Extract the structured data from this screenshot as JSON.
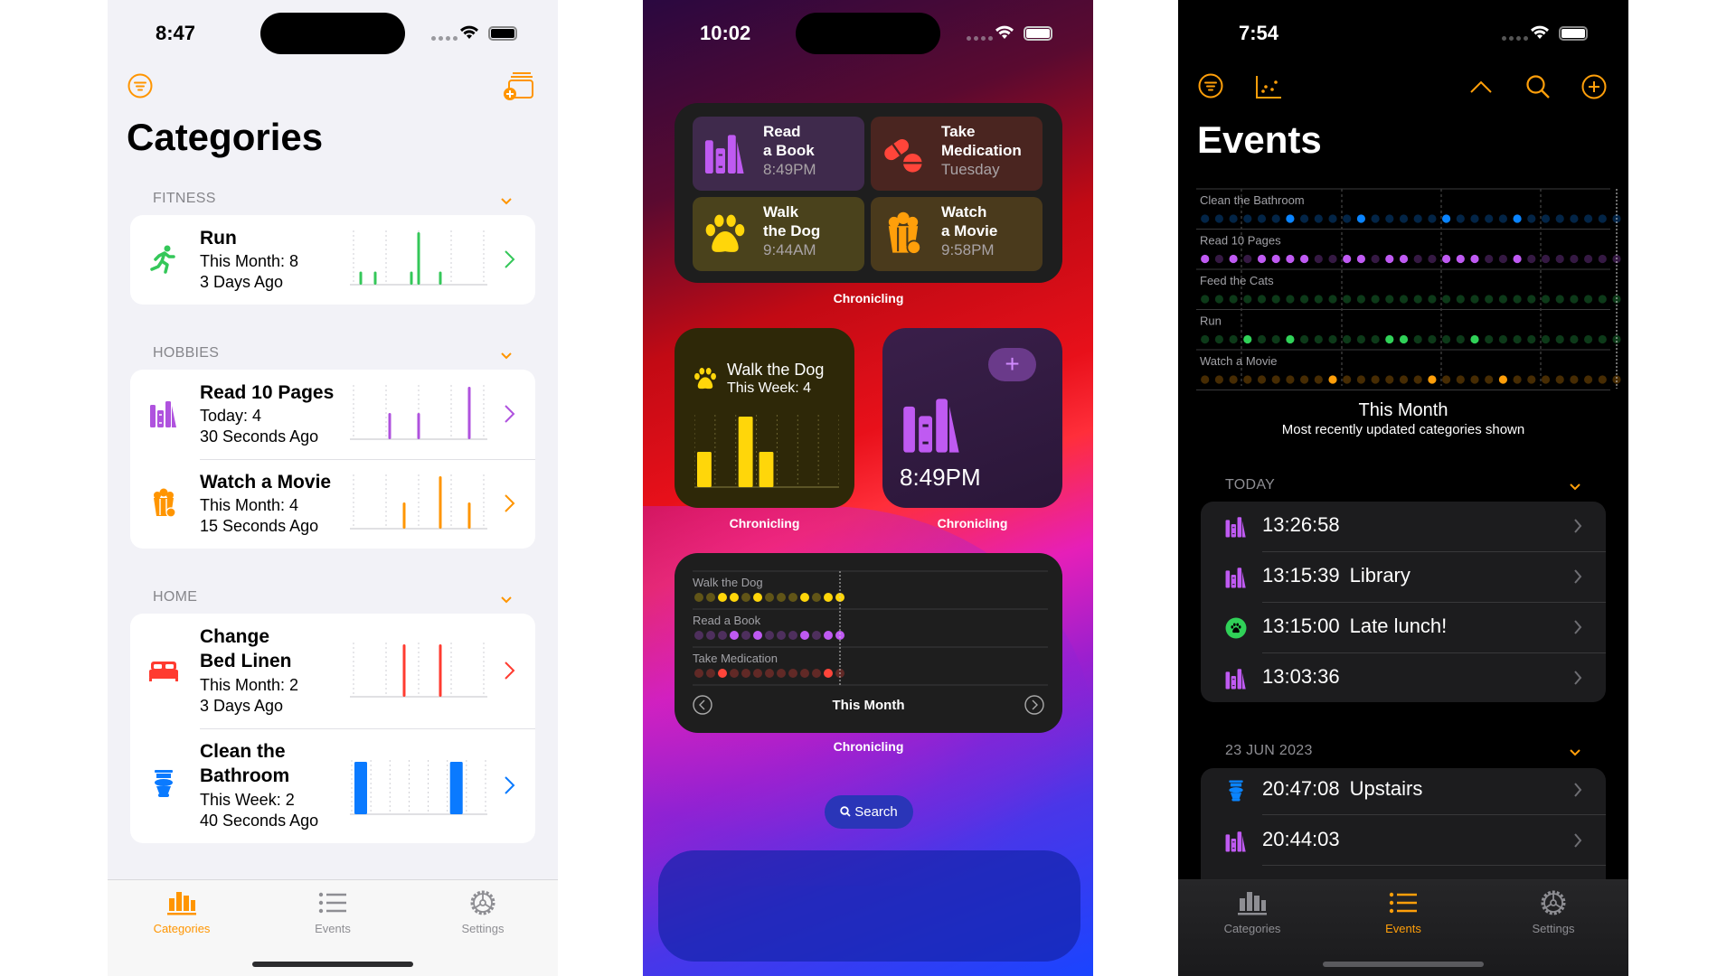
{
  "left_phone": {
    "status": {
      "time": "8:47"
    },
    "toolbar": {
      "filter_icon": "line-3-horizontal-decrease-circle",
      "add_icon": "rectangle-stack-badge-plus"
    },
    "title": "Categories",
    "accent": "#ff9500",
    "sections": [
      {
        "header": "FITNESS",
        "rows": [
          {
            "icon": "figure-run",
            "color": "#34c759",
            "title_lines": [
              "Run"
            ],
            "subtitle": "This Month: 8",
            "updated": "3 Days Ago",
            "chart_values": [
              0,
              1,
              0,
              1,
              0,
              0,
              0,
              0,
              1,
              4,
              0,
              0,
              1,
              0,
              0,
              0,
              0,
              0,
              0
            ]
          }
        ]
      },
      {
        "header": "HOBBIES",
        "rows": [
          {
            "icon": "books-vertical",
            "color": "#af52de",
            "title_lines": [
              "Read 10 Pages"
            ],
            "subtitle": "Today: 4",
            "updated": "30 Seconds Ago",
            "chart_values": [
              0,
              0,
              0,
              0,
              0,
              1,
              0,
              0,
              0,
              1,
              0,
              0,
              0,
              0,
              0,
              0,
              2,
              0,
              0
            ]
          },
          {
            "icon": "popcorn",
            "color": "#ff9500",
            "title_lines": [
              "Watch a Movie"
            ],
            "subtitle": "This Month: 4",
            "updated": "15 Seconds Ago",
            "chart_values": [
              0,
              0,
              0,
              0,
              0,
              0,
              0,
              1,
              0,
              0,
              0,
              0,
              2,
              0,
              0,
              0,
              1,
              0,
              0
            ]
          }
        ]
      },
      {
        "header": "HOME",
        "rows": [
          {
            "icon": "bed-double",
            "color": "#ff3b30",
            "title_lines": [
              "Change",
              "Bed Linen"
            ],
            "subtitle": "This Month: 2",
            "updated": "3 Days Ago",
            "chart_values": [
              0,
              0,
              0,
              0,
              0,
              0,
              0,
              1,
              0,
              0,
              0,
              0,
              1,
              0,
              0,
              0,
              0,
              0,
              0
            ]
          },
          {
            "icon": "toilet",
            "color": "#0a7aff",
            "title_lines": [
              "Clean the",
              "Bathroom"
            ],
            "subtitle": "This Week: 2",
            "updated": "40 Seconds Ago",
            "chart_values": [
              1,
              0,
              0,
              0,
              0,
              1,
              0
            ]
          }
        ]
      }
    ],
    "tabs": [
      {
        "label": "Categories",
        "icon": "chart-bar",
        "active": true
      },
      {
        "label": "Events",
        "icon": "list-bullet",
        "active": false
      },
      {
        "label": "Settings",
        "icon": "gear",
        "active": false
      }
    ]
  },
  "middle_phone": {
    "status": {
      "time": "10:02"
    },
    "widget_large": {
      "tiles": [
        {
          "title_lines": [
            "Read",
            "a Book"
          ],
          "time": "8:49PM",
          "icon": "books-vertical",
          "bg": "#3f2a4c",
          "color": "#bf5af2"
        },
        {
          "title_lines": [
            "Take",
            "Medication"
          ],
          "time": "Tuesday",
          "icon": "pills",
          "bg": "#4a2520",
          "color": "#ff453a"
        },
        {
          "title_lines": [
            "Walk",
            "the Dog"
          ],
          "time": "9:44AM",
          "icon": "pawprint",
          "bg": "#4a421c",
          "color": "#ffd60a"
        },
        {
          "title_lines": [
            "Watch",
            "a Movie"
          ],
          "time": "9:58PM",
          "icon": "popcorn",
          "bg": "#4a3a1c",
          "color": "#ff9f0a"
        }
      ],
      "app_label": "Chronicling"
    },
    "widget_dog": {
      "title": "Walk the Dog",
      "subtitle": "This Week: 4",
      "icon": "pawprint",
      "chart_values": [
        1,
        0,
        2,
        1,
        0,
        0,
        0
      ],
      "app_label": "Chronicling"
    },
    "widget_book": {
      "icon": "books-vertical",
      "time": "8:49PM",
      "add_button": "+",
      "app_label": "Chronicling"
    },
    "widget_month": {
      "rows": [
        {
          "label": "Walk the Dog",
          "color": "#ffd60a",
          "dots": [
            0,
            0,
            1,
            1,
            0,
            1,
            0,
            0,
            0,
            1,
            0,
            1,
            1
          ]
        },
        {
          "label": "Read a Book",
          "color": "#bf5af2",
          "dots": [
            0,
            0,
            0,
            1,
            0,
            1,
            0,
            0,
            0,
            1,
            0,
            1,
            1
          ]
        },
        {
          "label": "Take Medication",
          "color": "#ff453a",
          "dots": [
            0,
            0,
            1,
            0,
            0,
            0,
            0,
            0,
            0,
            0,
            0,
            1,
            0
          ]
        }
      ],
      "period": "This Month",
      "app_label": "Chronicling"
    },
    "search_label": "Search"
  },
  "right_phone": {
    "status": {
      "time": "7:54"
    },
    "title": "Events",
    "toolbar_icons": [
      "line-3-horizontal-decrease-circle",
      "chart-dots-scatter",
      "chevron-up",
      "magnifyingglass",
      "plus-circle"
    ],
    "timeline": {
      "rows": [
        {
          "label": "Clean the Bathroom",
          "color": "#0a84ff",
          "active": [
            7,
            12,
            18,
            23
          ]
        },
        {
          "label": "Read 10 Pages",
          "color": "#bf5af2",
          "active": [
            1,
            3,
            5,
            6,
            7,
            8,
            11,
            12,
            14,
            15,
            18,
            19,
            20,
            23
          ]
        },
        {
          "label": "Feed the Cats",
          "color": "#30d158",
          "active": []
        },
        {
          "label": "Run",
          "color": "#30d158",
          "active": [
            4,
            7,
            14,
            15,
            20
          ]
        },
        {
          "label": "Watch a Movie",
          "color": "#ff9f0a",
          "active": [
            10,
            17,
            22
          ]
        }
      ],
      "days": 30,
      "caption": "This Month",
      "subcaption": "Most recently updated categories shown"
    },
    "sections": [
      {
        "header": "TODAY",
        "events": [
          {
            "icon": "books-vertical",
            "color": "#bf5af2",
            "time": "13:26:58",
            "note": ""
          },
          {
            "icon": "books-vertical",
            "color": "#bf5af2",
            "time": "13:15:39",
            "note": "Library"
          },
          {
            "icon": "pawprint-circle",
            "color": "#30d158",
            "time": "13:15:00",
            "note": "Late lunch!"
          },
          {
            "icon": "books-vertical",
            "color": "#bf5af2",
            "time": "13:03:36",
            "note": ""
          }
        ]
      },
      {
        "header": "23 JUN 2023",
        "events": [
          {
            "icon": "toilet",
            "color": "#0a84ff",
            "time": "20:47:08",
            "note": "Upstairs"
          },
          {
            "icon": "books-vertical",
            "color": "#bf5af2",
            "time": "20:44:03",
            "note": ""
          }
        ]
      }
    ],
    "tabs": [
      {
        "label": "Categories",
        "icon": "chart-bar",
        "active": false
      },
      {
        "label": "Events",
        "icon": "list-bullet",
        "active": true
      },
      {
        "label": "Settings",
        "icon": "gear",
        "active": false
      }
    ]
  }
}
